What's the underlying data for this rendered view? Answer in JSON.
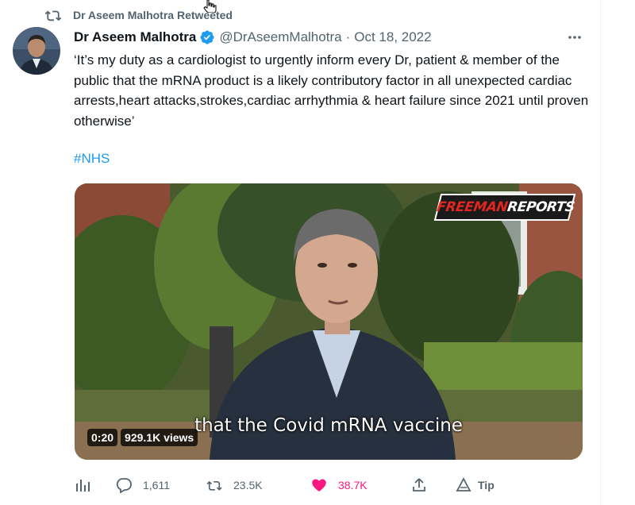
{
  "retweet_context": {
    "text": "Dr Aseem Malhotra Retweeted",
    "icon": "retweet-icon"
  },
  "tweet": {
    "author": {
      "name": "Dr Aseem Malhotra",
      "handle": "@DrAseemMalhotra",
      "verified": true
    },
    "separator": "·",
    "date": "Oct 18, 2022",
    "text": "‘It’s my duty as a cardiologist to urgently inform every Dr, patient & member of the public that the mRNA product is a likely contributory factor in all unexpected cardiac arrests,heart attacks,strokes,cardiac arrhythmia & heart failure since 2021 until proven otherwise’",
    "hashtag": "#NHS",
    "media": {
      "logo_part1": "FREEMAN",
      "logo_part2": "REPORTS",
      "subtitle": "that the Covid mRNA vaccine",
      "duration": "0:20",
      "views": "929.1K views"
    },
    "actions": {
      "analytics_icon": "analytics-icon",
      "replies": "1,611",
      "retweets": "23.5K",
      "likes": "38.7K",
      "liked": true,
      "share_icon": "share-icon",
      "tip_label": "Tip"
    }
  },
  "colors": {
    "accent": "#1d9bf0",
    "like": "#f91880",
    "muted": "#536471",
    "text": "#0f1419"
  }
}
